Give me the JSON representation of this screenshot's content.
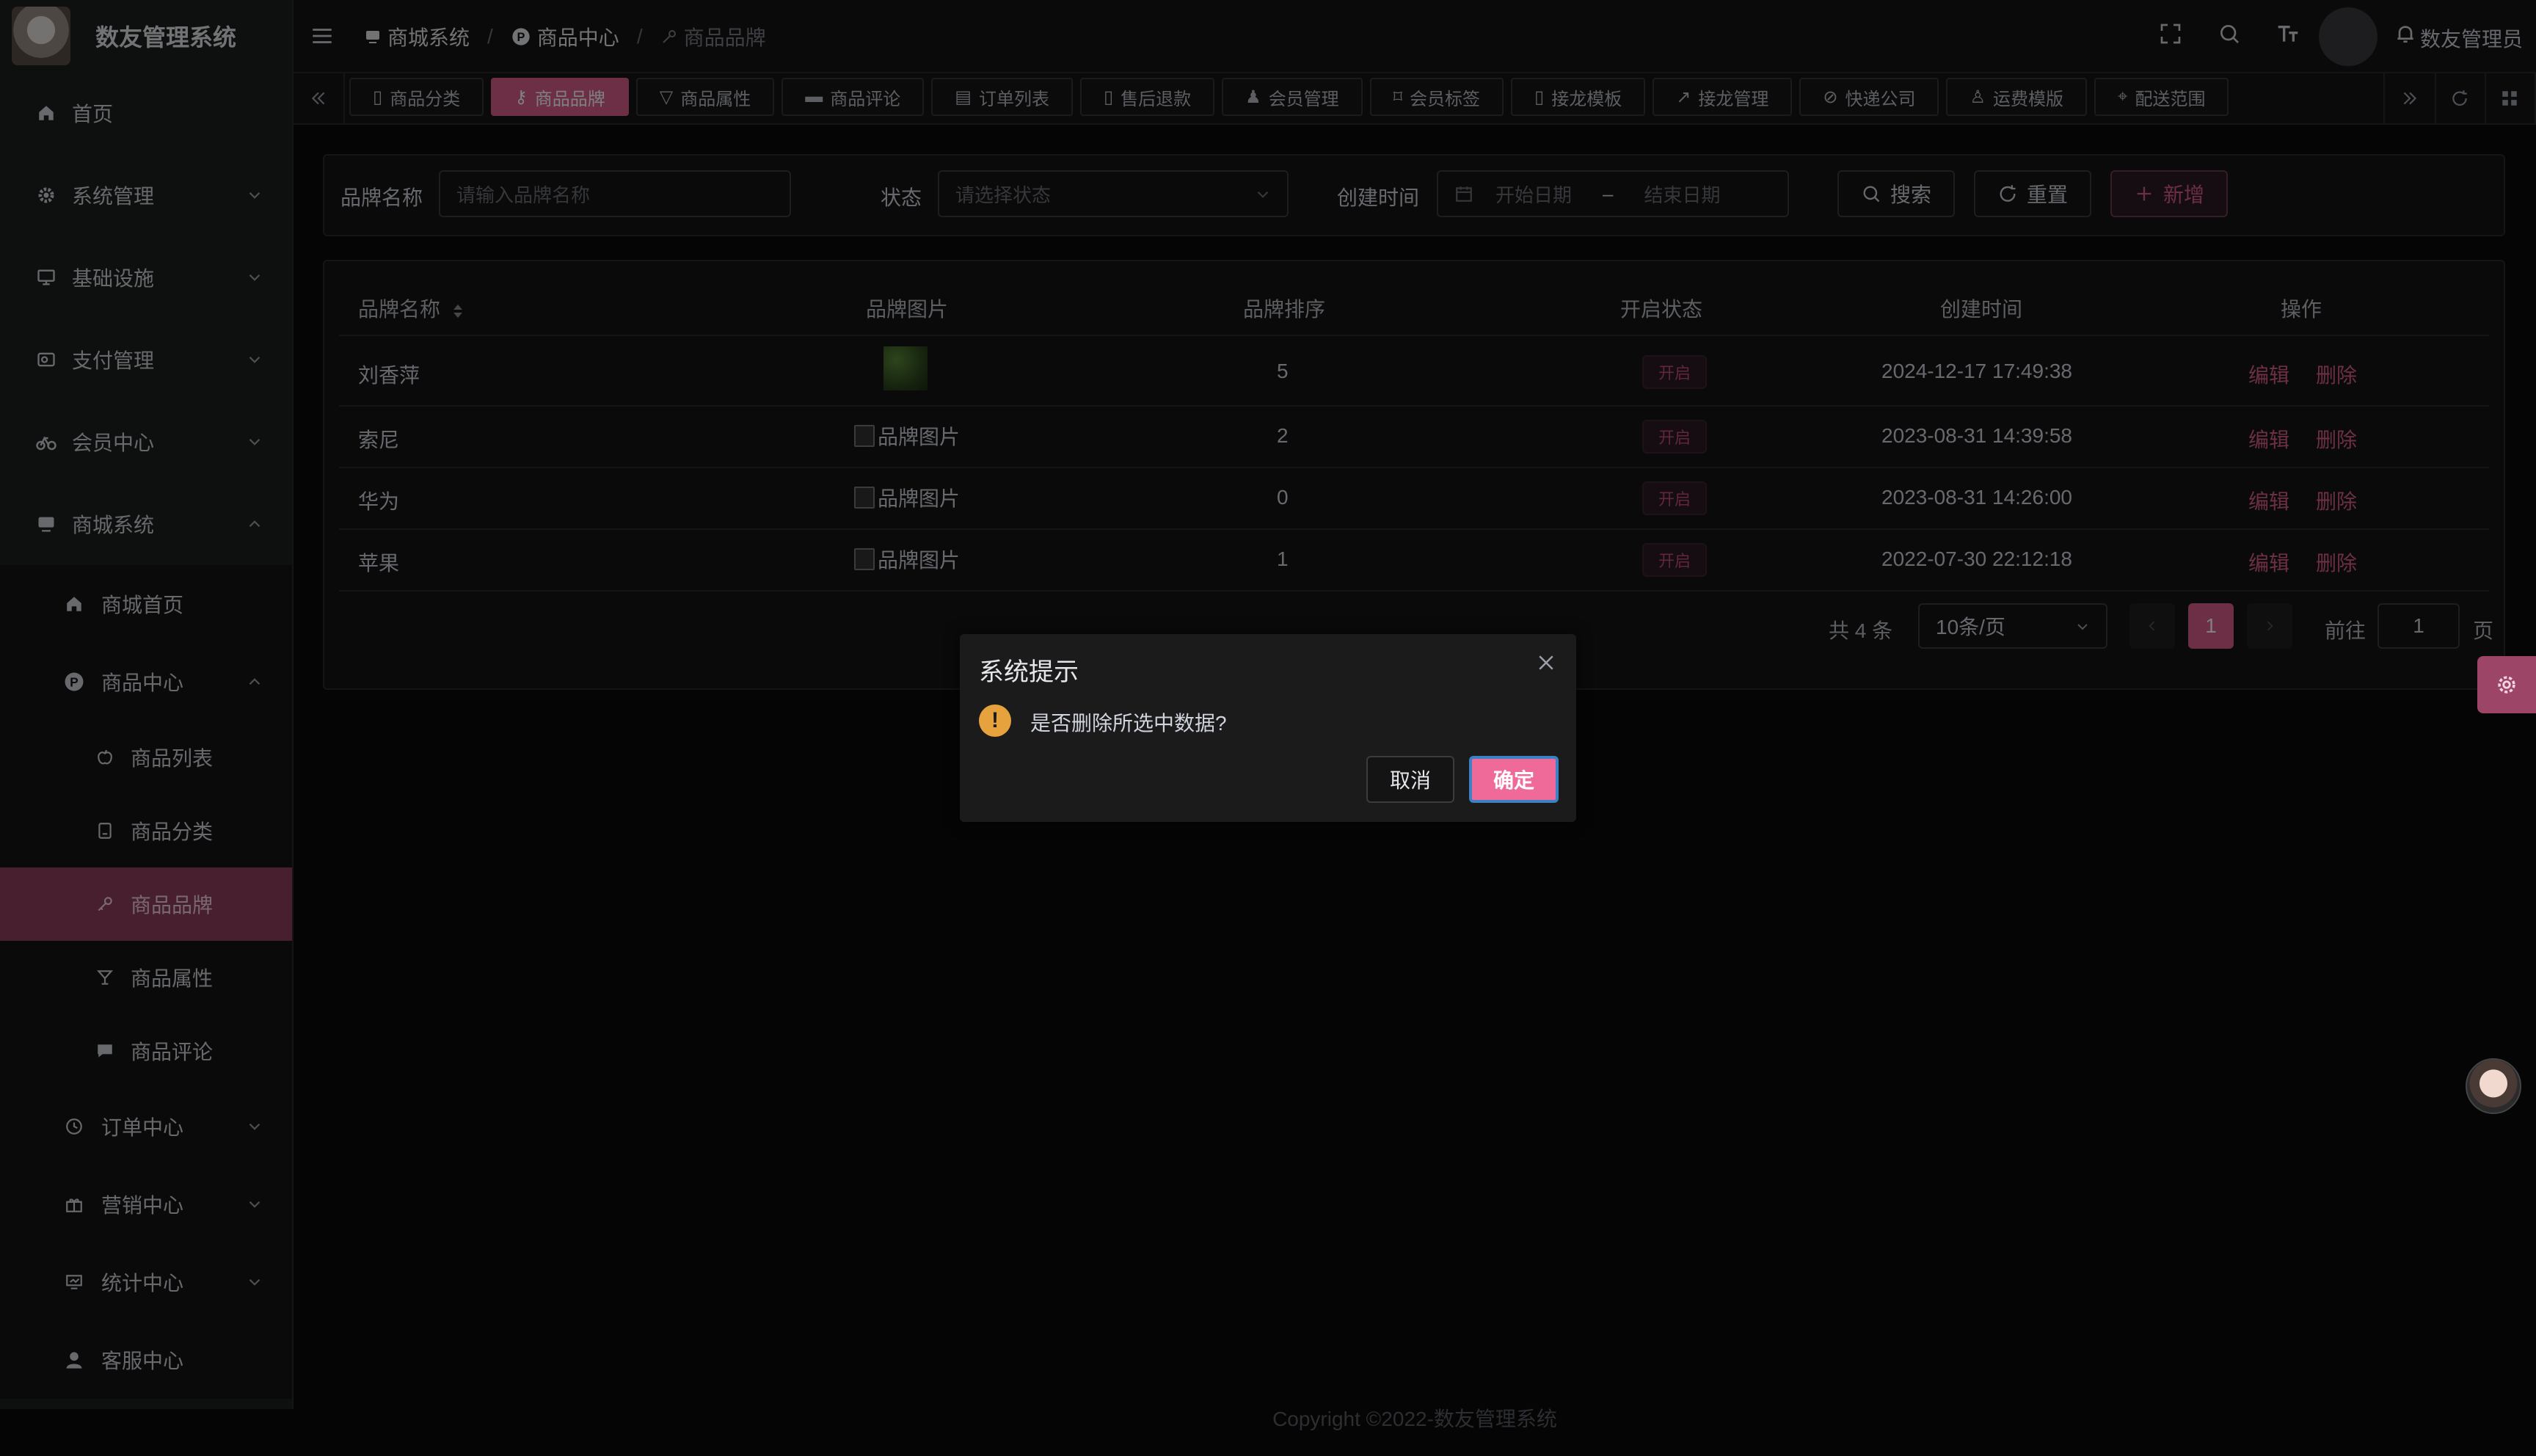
{
  "app": {
    "title": "数友管理系统"
  },
  "sidebar": {
    "items": [
      {
        "label": "首页",
        "icon": "home-icon"
      },
      {
        "label": "系统管理",
        "icon": "gear-icon"
      },
      {
        "label": "基础设施",
        "icon": "monitor-icon"
      },
      {
        "label": "支付管理",
        "icon": "wallet-icon"
      },
      {
        "label": "会员中心",
        "icon": "bicycle-icon"
      },
      {
        "label": "商城系统",
        "icon": "shop-icon"
      }
    ],
    "mall_children": [
      {
        "label": "商城首页",
        "icon": "home-icon"
      },
      {
        "label": "商品中心",
        "icon": "p-icon"
      }
    ],
    "product_children": [
      {
        "label": "商品列表",
        "icon": "apple-icon"
      },
      {
        "label": "商品分类",
        "icon": "category-icon"
      },
      {
        "label": "商品品牌",
        "icon": "key-icon"
      },
      {
        "label": "商品属性",
        "icon": "cocktail-icon"
      },
      {
        "label": "商品评论",
        "icon": "comment-icon"
      }
    ],
    "more_children": [
      {
        "label": "订单中心",
        "icon": "order-icon"
      },
      {
        "label": "营销中心",
        "icon": "gift-icon"
      },
      {
        "label": "统计中心",
        "icon": "chart-icon"
      },
      {
        "label": "客服中心",
        "icon": "user-icon"
      }
    ]
  },
  "header": {
    "breadcrumb": [
      "商城系统",
      "商品中心",
      "商品品牌"
    ],
    "user_name": "数友管理员"
  },
  "tabs": [
    {
      "label": "商品分类",
      "active": false
    },
    {
      "label": "商品品牌",
      "active": true
    },
    {
      "label": "商品属性",
      "active": false
    },
    {
      "label": "商品评论",
      "active": false
    },
    {
      "label": "订单列表",
      "active": false
    },
    {
      "label": "售后退款",
      "active": false
    },
    {
      "label": "会员管理",
      "active": false
    },
    {
      "label": "会员标签",
      "active": false
    },
    {
      "label": "接龙模板",
      "active": false
    },
    {
      "label": "接龙管理",
      "active": false
    },
    {
      "label": "快递公司",
      "active": false
    },
    {
      "label": "运费模版",
      "active": false
    },
    {
      "label": "配送范围",
      "active": false
    }
  ],
  "search": {
    "brand_name_label": "品牌名称",
    "brand_name_placeholder": "请输入品牌名称",
    "status_label": "状态",
    "status_placeholder": "请选择状态",
    "created_label": "创建时间",
    "start_date": "开始日期",
    "date_sep": "–",
    "end_date": "结束日期",
    "search_btn": "搜索",
    "reset_btn": "重置",
    "add_btn": "新增"
  },
  "table": {
    "headers": [
      "品牌名称",
      "品牌图片",
      "品牌排序",
      "开启状态",
      "创建时间",
      "操作"
    ],
    "rows": [
      {
        "name": "刘香萍",
        "image": "",
        "sort": "5",
        "status": "开启",
        "created": "2024-12-17 17:49:38"
      },
      {
        "name": "索尼",
        "image": "品牌图片",
        "sort": "2",
        "status": "开启",
        "created": "2023-08-31 14:39:58"
      },
      {
        "name": "华为",
        "image": "品牌图片",
        "sort": "0",
        "status": "开启",
        "created": "2023-08-31 14:26:00"
      },
      {
        "name": "苹果",
        "image": "品牌图片",
        "sort": "1",
        "status": "开启",
        "created": "2022-07-30 22:12:18"
      }
    ],
    "edit_label": "编辑",
    "delete_label": "删除"
  },
  "pagination": {
    "total": "共 4 条",
    "page_size": "10条/页",
    "current": "1",
    "goto_label": "前往",
    "goto_value": "1",
    "page_suffix": "页"
  },
  "footer": "Copyright ©2022-数友管理系统",
  "dialog": {
    "title": "系统提示",
    "message": "是否删除所选中数据?",
    "cancel": "取消",
    "confirm": "确定"
  },
  "colors": {
    "accent": "#d85e8b",
    "warning": "#e6a23c",
    "sidebar_bg": "#1d1e1f",
    "active_menu": "#8e3e5c"
  }
}
